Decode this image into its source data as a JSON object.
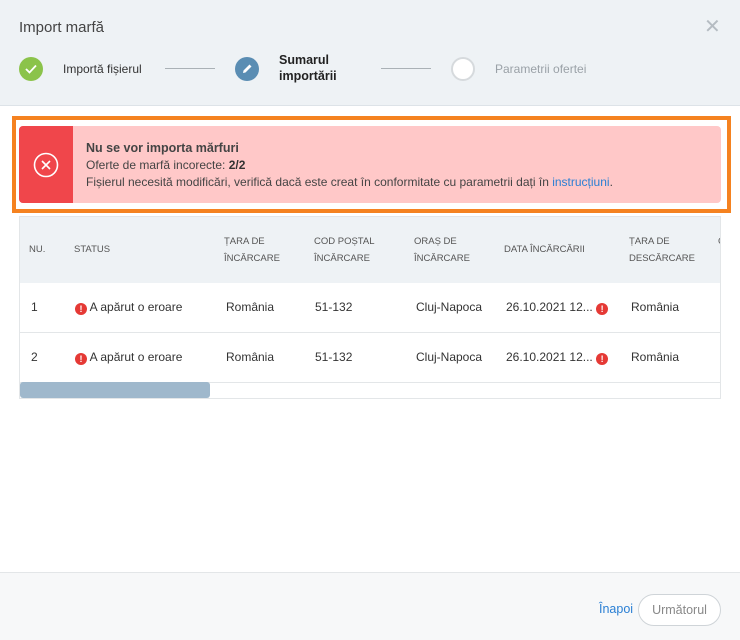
{
  "dialog": {
    "title": "Import marfă",
    "close_icon": "close-icon"
  },
  "steps": [
    {
      "label": "Importă fișierul",
      "status": "done",
      "icon": "check-icon"
    },
    {
      "label": "Sumarul importării",
      "status": "active",
      "icon": "pencil-icon"
    },
    {
      "label": "Parametrii ofertei",
      "status": "pending",
      "icon": ""
    }
  ],
  "alert": {
    "title": "Nu se vor importa mărfuri",
    "line2_text": "Oferte de marfă incorecte: ",
    "line2_count": "2/2",
    "line3_text": "Fișierul necesită modificări, verifică dacă este creat în conformitate cu parametrii dați în ",
    "line3_link": "instrucțiuni",
    "line3_end": ".",
    "icon": "error-circle-icon",
    "colors": {
      "background": "#ffc8c8",
      "side": "#f0464b",
      "frame": "#f58220"
    }
  },
  "table": {
    "headers": [
      "NU.",
      "STATUS",
      "ȚARA DE ÎNCĂRCARE",
      "COD POȘTAL ÎNCĂRCARE",
      "ORAȘ DE ÎNCĂRCARE",
      "DATA ÎNCĂRCĂRII",
      "ȚARA DE DESCĂRCARE",
      "C"
    ],
    "rows": [
      {
        "nr": "1",
        "status": "A apărut o eroare",
        "tara_incarcare": "România",
        "cod_postal": "51-132",
        "oras": "Cluj-Napoca",
        "data": "26.10.2021 12...",
        "tara_descarcare": "România"
      },
      {
        "nr": "2",
        "status": "A apărut o eroare",
        "tara_incarcare": "România",
        "cod_postal": "51-132",
        "oras": "Cluj-Napoca",
        "data": "26.10.2021 12...",
        "tara_descarcare": "România"
      }
    ]
  },
  "footer": {
    "back_label": "Înapoi",
    "next_label": "Următorul"
  }
}
